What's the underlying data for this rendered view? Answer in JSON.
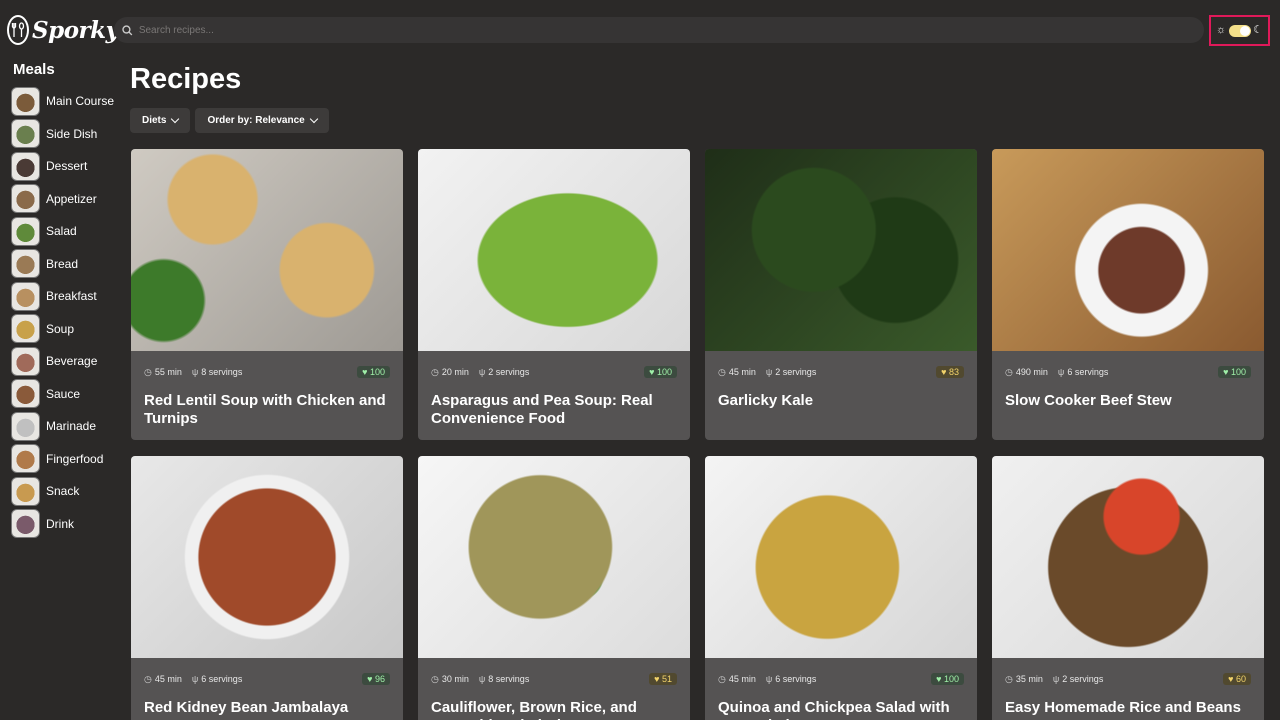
{
  "app": {
    "name": "Sporky"
  },
  "search": {
    "placeholder": "Search recipes..."
  },
  "sidebar": {
    "title": "Meals",
    "items": [
      {
        "label": "Main Course",
        "color": "#7b5b3a"
      },
      {
        "label": "Side Dish",
        "color": "#6a7f4e"
      },
      {
        "label": "Dessert",
        "color": "#4a3a35"
      },
      {
        "label": "Appetizer",
        "color": "#8a6a4a"
      },
      {
        "label": "Salad",
        "color": "#5f8a3a"
      },
      {
        "label": "Bread",
        "color": "#9a7a55"
      },
      {
        "label": "Breakfast",
        "color": "#b89060"
      },
      {
        "label": "Soup",
        "color": "#c8a14a"
      },
      {
        "label": "Beverage",
        "color": "#a06a5a"
      },
      {
        "label": "Sauce",
        "color": "#8a5a3a"
      },
      {
        "label": "Marinade",
        "color": "#c0c0c0"
      },
      {
        "label": "Fingerfood",
        "color": "#b07a4a"
      },
      {
        "label": "Snack",
        "color": "#c89a50"
      },
      {
        "label": "Drink",
        "color": "#7a5a6a"
      }
    ]
  },
  "main": {
    "title": "Recipes",
    "filters": [
      {
        "label": "Diets"
      },
      {
        "label": "Order by: Relevance"
      }
    ],
    "recipes": [
      {
        "title": "Red Lentil Soup with Chicken and Turnips",
        "time": "55 min",
        "servings": "8 servings",
        "score": "100",
        "tier": "high",
        "img": "radial-gradient(circle at 30% 25%, #d9b26e 0 18%, transparent 19%), radial-gradient(circle at 72% 60%, #d9b26e 0 20%, transparent 21%), radial-gradient(circle at 12% 75%, #3d7a2a 0 14%, transparent 15%), linear-gradient(135deg, #cfcac2, #9e9a94)"
      },
      {
        "title": "Asparagus and Pea Soup: Real Convenience Food",
        "time": "20 min",
        "servings": "2 servings",
        "score": "100",
        "tier": "high",
        "img": "radial-gradient(ellipse at 55% 55%, #7ab33a 0 42%, transparent 43%), linear-gradient(135deg, #f2f2f2, #d8d8d8)"
      },
      {
        "title": "Garlicky Kale",
        "time": "45 min",
        "servings": "2 servings",
        "score": "83",
        "tier": "mid",
        "img": "radial-gradient(circle at 40% 40%, #2b4a1e 0 30%, transparent 31%), radial-gradient(circle at 70% 55%, #1f3a16 0 28%, transparent 29%), linear-gradient(135deg, #1f2e18, #3a5a2a)"
      },
      {
        "title": "Slow Cooker Beef Stew",
        "time": "490 min",
        "servings": "6 servings",
        "score": "100",
        "tier": "high",
        "img": "radial-gradient(circle at 55% 60%, #6e3a2a 0 22%, #f4f4f4 23% 34%, transparent 35%), linear-gradient(135deg, #c89a5a, #8a5a30)"
      },
      {
        "title": "Red Kidney Bean Jambalaya",
        "time": "45 min",
        "servings": "6 servings",
        "score": "96",
        "tier": "high",
        "img": "radial-gradient(circle at 50% 50%, #a04a2a 0 40%, #f0f0f0 41% 48%, transparent 49%), linear-gradient(135deg, #e8e8e8, #c8c8c8)"
      },
      {
        "title": "Cauliflower, Brown Rice, and Vegetable Fried Rice",
        "time": "30 min",
        "servings": "8 servings",
        "score": "51",
        "tier": "mid",
        "img": "radial-gradient(circle at 45% 45%, #a0965a 0 38%, transparent 39%), radial-gradient(circle at 60% 60%, #3a8a2a 0 10%, transparent 11%), linear-gradient(135deg, #f6f6f6, #dcdcdc)"
      },
      {
        "title": "Quinoa and Chickpea Salad with Sun-Dried Tomatoes",
        "time": "45 min",
        "servings": "6 servings",
        "score": "100",
        "tier": "high",
        "img": "radial-gradient(circle at 45% 55%, #c9a440 0 38%, transparent 39%), linear-gradient(135deg, #f4f4f4, #d6d6d6)"
      },
      {
        "title": "Easy Homemade Rice and Beans",
        "time": "35 min",
        "servings": "2 servings",
        "score": "60",
        "tier": "mid",
        "img": "radial-gradient(circle at 55% 30%, #d8452a 0 18%, transparent 19%), radial-gradient(circle at 50% 55%, #6a4a2a 0 45%, transparent 46%), linear-gradient(135deg, #f0f0f0, #d8d8d8)"
      }
    ]
  }
}
